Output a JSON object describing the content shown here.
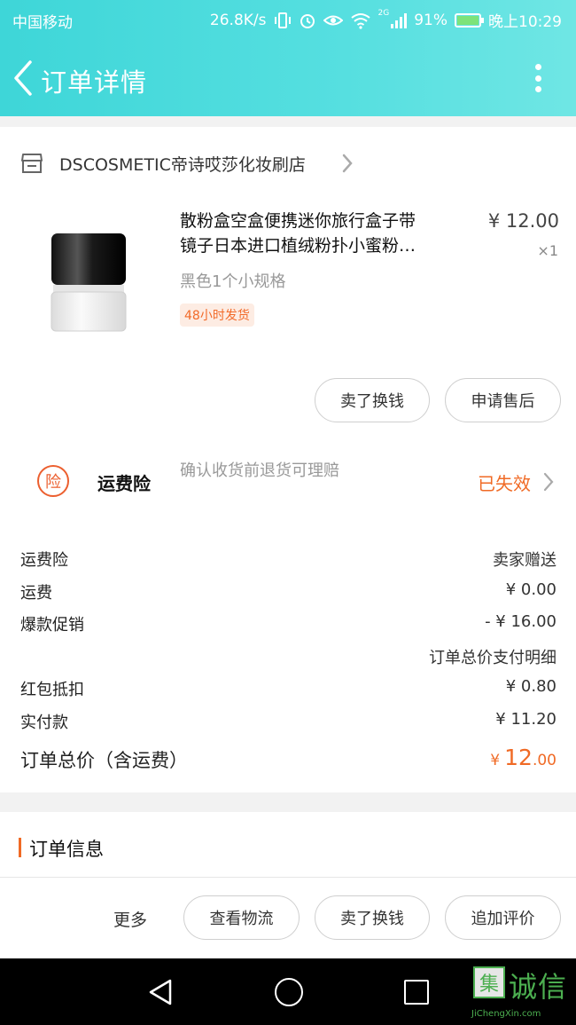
{
  "status_bar": {
    "carrier": "中国移动",
    "speed": "26.8K/s",
    "network": "2G",
    "battery": "91%",
    "battery_level": 0.91,
    "time": "晚上10:29"
  },
  "header": {
    "title": "订单详情",
    "back_icon": "chevron-left-icon",
    "more_icon": "more-vertical-icon"
  },
  "store": {
    "name": "DSCOSMETIC帝诗哎莎化妆刷店",
    "icon": "store-icon"
  },
  "product": {
    "title_line1": "散粉盒空盒便携迷你旅行盒子带",
    "title_line2": "镜子日本进口植绒粉扑小蜜粉…",
    "price": "¥ 12.00",
    "quantity": "×1",
    "spec": "黑色1个小规格",
    "badge": "48小时发货"
  },
  "product_actions": {
    "sell_label": "卖了换钱",
    "aftersale_label": "申请售后"
  },
  "insurance": {
    "icon_label": "险",
    "title": "运费险",
    "description": "确认收货前退货可理赔",
    "status": "已失效"
  },
  "summary": {
    "shipping_insurance_label": "运费险",
    "shipping_insurance_value": "卖家赠送",
    "shipping_label": "运费",
    "shipping_value": "¥ 0.00",
    "promo_label": "爆款促销",
    "promo_value": "- ¥ 16.00",
    "payment_detail_link": "订单总价支付明细",
    "redpacket_label": "红包抵扣",
    "redpacket_value": "¥ 0.80",
    "paid_label": "实付款",
    "paid_value": "¥ 11.20",
    "total_label": "订单总价（含运费）",
    "total_symbol": "¥",
    "total_int": "12",
    "total_dec": ".00"
  },
  "order_info": {
    "title": "订单信息"
  },
  "bottom_actions": {
    "more_label": "更多",
    "logistics_label": "查看物流",
    "sell_label": "卖了换钱",
    "review_label": "追加评价"
  },
  "watermark": {
    "box_char": "集",
    "text": "诚信",
    "url": "JiChengXin.com"
  },
  "colors": {
    "header_gradient_start": "#3ed6d8",
    "header_gradient_end": "#6fe6e4",
    "accent_orange": "#f06a25"
  }
}
